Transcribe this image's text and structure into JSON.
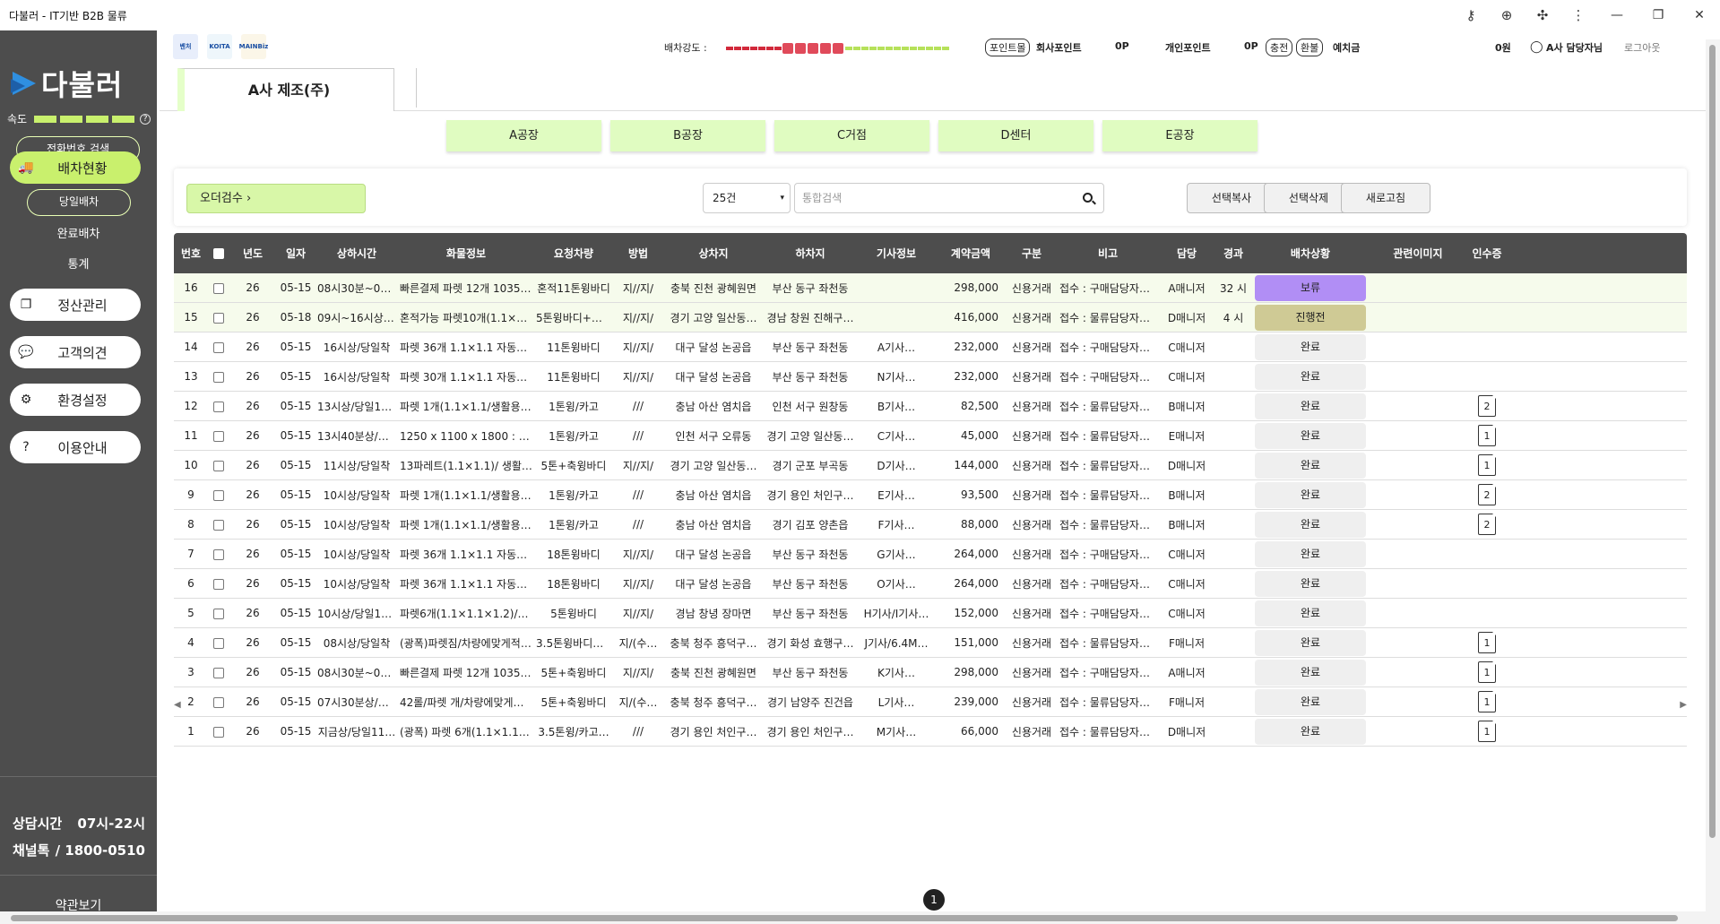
{
  "window": {
    "title": "다불러 - IT기반 B2B 물류"
  },
  "sidebar": {
    "logo_text": "다불러",
    "speed_label": "속도",
    "phone_search": "전화번호 검색",
    "menu": [
      {
        "label": "배차현황",
        "icon": "truck-icon"
      },
      {
        "label": "정산관리",
        "icon": "copy-icon"
      },
      {
        "label": "고객의견",
        "icon": "chat-icon"
      },
      {
        "label": "환경설정",
        "icon": "gear-icon"
      },
      {
        "label": "이용안내",
        "icon": "help-icon"
      }
    ],
    "sub_items": [
      "당일배차",
      "완료배차",
      "통계"
    ],
    "hours_label": "상담시간",
    "hours_value": "07시-22시",
    "channel_label": "채널톡",
    "channel_value": "/ 1800-0510",
    "terms": "약관보기"
  },
  "header": {
    "certs": [
      "벤처",
      "KOITA",
      "MAINBiz"
    ],
    "strength_label": "배차강도 :",
    "point_shop": "포인트몰",
    "company_point_label": "회사포인트",
    "company_point_value": "0P",
    "personal_point_label": "개인포인트",
    "personal_point_value": "0P",
    "charge": "충전",
    "refund": "환불",
    "deposit_label": "예치금",
    "deposit_value": "0원",
    "user": "A사 담당자님",
    "logout": "로그아웃"
  },
  "tab": {
    "label": "A사 제조(주)"
  },
  "locations": [
    "A공장",
    "B공장",
    "C거점",
    "D센터",
    "E공장"
  ],
  "toolbar": {
    "order_check": "오더검수 ›",
    "page_size": "25건",
    "search_placeholder": "통합검색",
    "copy": "선택복사",
    "delete": "선택삭제",
    "refresh": "새로고침"
  },
  "table": {
    "columns": [
      "번호",
      "",
      "년도",
      "일자",
      "상하시간",
      "화물정보",
      "요청차량",
      "방법",
      "상차지",
      "하차지",
      "기사정보",
      "계약금액",
      "구분",
      "비고",
      "담당",
      "경과",
      "배차상황",
      "관련이미지",
      "인수증"
    ],
    "rows": [
      {
        "no": "16",
        "year": "26",
        "date": "05-15",
        "time": "08시30분~09시…",
        "cargo": "빠른결제 파렛 12개 1035×930",
        "vehicle": "혼적11톤윙바디",
        "method": "지//지/",
        "load": "충북 진천 광혜원면",
        "unload": "부산 동구 좌천동",
        "driver": "",
        "amount": "298,000",
        "type": "신용거래",
        "note": "접수 : 구매담당자님 …",
        "manager": "A매니저",
        "elapsed": "32 시",
        "status": "보류",
        "receipt": ""
      },
      {
        "no": "15",
        "year": "26",
        "date": "05-18",
        "time": "09시~16시상/내…",
        "cargo": "혼적가능 파렛10개(1.1×1.1)…",
        "vehicle": "5톤윙바디+도…",
        "method": "지//지/",
        "load": "경기 고양 일산동…",
        "unload": "경남 창원 진해구…",
        "driver": "",
        "amount": "416,000",
        "type": "신용거래",
        "note": "접수 : 물류담당자님 …",
        "manager": "D매니저",
        "elapsed": "4 시",
        "status": "진행전",
        "receipt": ""
      },
      {
        "no": "14",
        "year": "26",
        "date": "05-15",
        "time": "16시상/당일착",
        "cargo": "파렛 36개 1.1×1.1 자동차부품",
        "vehicle": "11톤윙바디",
        "method": "지//지/",
        "load": "대구 달성 논공읍",
        "unload": "부산 동구 좌천동",
        "driver": "A기사…",
        "amount": "232,000",
        "type": "신용거래",
        "note": "접수 : 구매담당자님 …",
        "manager": "C매니저",
        "elapsed": "",
        "status": "완료",
        "receipt": ""
      },
      {
        "no": "13",
        "year": "26",
        "date": "05-15",
        "time": "16시상/당일착",
        "cargo": "파렛 30개 1.1×1.1 자동차부품",
        "vehicle": "11톤윙바디",
        "method": "지//지/",
        "load": "대구 달성 논공읍",
        "unload": "부산 동구 좌천동",
        "driver": "N기사…",
        "amount": "232,000",
        "type": "신용거래",
        "note": "접수 : 구매담당자님 …",
        "manager": "C매니저",
        "elapsed": "",
        "status": "완료",
        "receipt": ""
      },
      {
        "no": "12",
        "year": "26",
        "date": "05-15",
        "time": "13시상/당일17…",
        "cargo": "파렛 1개(1.1×1.1/생활용품류)",
        "vehicle": "1톤윙/카고",
        "method": "///",
        "load": "충남 아산 염치읍",
        "unload": "인천 서구 원창동",
        "driver": "B기사…",
        "amount": "82,500",
        "type": "신용거래",
        "note": "접수 : 물류담당자님 …",
        "manager": "B매니저",
        "elapsed": "",
        "status": "완료",
        "receipt": "2"
      },
      {
        "no": "11",
        "year": "26",
        "date": "05-15",
        "time": "13시40분상/당…",
        "cargo": "1250 x 1100 x 1800 : 나무 …",
        "vehicle": "1톤윙/카고",
        "method": "///",
        "load": "인천 서구 오류동",
        "unload": "경기 고양 일산동…",
        "driver": "C기사…",
        "amount": "45,000",
        "type": "신용거래",
        "note": "접수 : 물류담당자님 …",
        "manager": "E매니저",
        "elapsed": "",
        "status": "완료",
        "receipt": "1"
      },
      {
        "no": "10",
        "year": "26",
        "date": "05-15",
        "time": "11시상/당일착",
        "cargo": "13파레트(1.1×1.1)/ 생활용…",
        "vehicle": "5톤+축윙바디",
        "method": "지//지/",
        "load": "경기 고양 일산동…",
        "unload": "경기 군포 부곡동",
        "driver": "D기사…",
        "amount": "144,000",
        "type": "신용거래",
        "note": "접수 : 물류담당자님 …",
        "manager": "D매니저",
        "elapsed": "",
        "status": "완료",
        "receipt": "1"
      },
      {
        "no": "9",
        "year": "26",
        "date": "05-15",
        "time": "10시상/당일착",
        "cargo": "파렛 1개(1.1×1.1/생활용품…",
        "vehicle": "1톤윙/카고",
        "method": "///",
        "load": "충남 아산 염치읍",
        "unload": "경기 용인 처인구…",
        "driver": "E기사…",
        "amount": "93,500",
        "type": "신용거래",
        "note": "접수 : 물류담당자님 …",
        "manager": "B매니저",
        "elapsed": "",
        "status": "완료",
        "receipt": "2"
      },
      {
        "no": "8",
        "year": "26",
        "date": "05-15",
        "time": "10시상/당일착",
        "cargo": "파렛 1개(1.1×1.1/생활용품…",
        "vehicle": "1톤윙/카고",
        "method": "///",
        "load": "충남 아산 염치읍",
        "unload": "경기 김포 양촌읍",
        "driver": "F기사…",
        "amount": "88,000",
        "type": "신용거래",
        "note": "접수 : 물류담당자님 …",
        "manager": "B매니저",
        "elapsed": "",
        "status": "완료",
        "receipt": "2"
      },
      {
        "no": "7",
        "year": "26",
        "date": "05-15",
        "time": "10시상/당일착",
        "cargo": "파렛 36개 1.1×1.1 자동차부품",
        "vehicle": "18톤윙바디",
        "method": "지//지/",
        "load": "대구 달성 논공읍",
        "unload": "부산 동구 좌천동",
        "driver": "G기사…",
        "amount": "264,000",
        "type": "신용거래",
        "note": "접수 : 구매담당자님 …",
        "manager": "C매니저",
        "elapsed": "",
        "status": "완료",
        "receipt": ""
      },
      {
        "no": "6",
        "year": "26",
        "date": "05-15",
        "time": "10시상/당일착",
        "cargo": "파렛 36개 1.1×1.1 자동차부품",
        "vehicle": "18톤윙바디",
        "method": "지//지/",
        "load": "대구 달성 논공읍",
        "unload": "부산 동구 좌천동",
        "driver": "O기사…",
        "amount": "264,000",
        "type": "신용거래",
        "note": "접수 : 구매담당자님 …",
        "manager": "C매니저",
        "elapsed": "",
        "status": "완료",
        "receipt": ""
      },
      {
        "no": "5",
        "year": "26",
        "date": "05-15",
        "time": "10시상/당일16…",
        "cargo": "파렛6개(1.1×1.1×1.2)/자동…",
        "vehicle": "5톤윙바디",
        "method": "지//지/",
        "load": "경남 창녕 장마면",
        "unload": "부산 동구 좌천동",
        "driver": "H기사/I기사…",
        "amount": "152,000",
        "type": "신용거래",
        "note": "접수 : 구매담당자님 …",
        "manager": "C매니저",
        "elapsed": "",
        "status": "완료",
        "receipt": ""
      },
      {
        "no": "4",
        "year": "26",
        "date": "05-15",
        "time": "08시상/당일착",
        "cargo": "(광폭)파렛짐/차량에맞게적재…",
        "vehicle": "3.5톤윙바디+…",
        "method": "지/(수…",
        "load": "충북 청주 흥덕구…",
        "unload": "경기 화성 효행구…",
        "driver": "J기사/6.4M…",
        "amount": "151,000",
        "type": "신용거래",
        "note": "접수 : 물류담당자님 …",
        "manager": "F매니저",
        "elapsed": "",
        "status": "완료",
        "receipt": "1"
      },
      {
        "no": "3",
        "year": "26",
        "date": "05-15",
        "time": "08시30분~09시…",
        "cargo": "빠른결제 파렛 12개 1035×930",
        "vehicle": "5톤+축윙바디",
        "method": "지//지/",
        "load": "충북 진천 광혜원면",
        "unload": "부산 동구 좌천동",
        "driver": "K기사…",
        "amount": "298,000",
        "type": "신용거래",
        "note": "접수 : 구매담당자님 …",
        "manager": "A매니저",
        "elapsed": "",
        "status": "완료",
        "receipt": "1"
      },
      {
        "no": "2",
        "year": "26",
        "date": "05-15",
        "time": "07시30분상/당…",
        "cargo": "42롤/파렛 개/차량에맞게적…",
        "vehicle": "5톤+축윙바디",
        "method": "지/(수…",
        "load": "충북 청주 흥덕구…",
        "unload": "경기 남양주 진건읍",
        "driver": "L기사…",
        "amount": "239,000",
        "type": "신용거래",
        "note": "접수 : 물류담당자님 …",
        "manager": "F매니저",
        "elapsed": "",
        "status": "완료",
        "receipt": "1"
      },
      {
        "no": "1",
        "year": "26",
        "date": "05-15",
        "time": "지금상/당일11…",
        "cargo": "(광폭) 파렛 6개(1.1×1.1/생활…",
        "vehicle": "3.5톤윙/카고…",
        "method": "///",
        "load": "경기 용인 처인구…",
        "unload": "경기 용인 처인구…",
        "driver": "M기사…",
        "amount": "66,000",
        "type": "신용거래",
        "note": "접수 : 물류담당자님 …",
        "manager": "D매니저",
        "elapsed": "",
        "status": "완료",
        "receipt": "1"
      }
    ]
  },
  "pagination": {
    "current": "1"
  }
}
